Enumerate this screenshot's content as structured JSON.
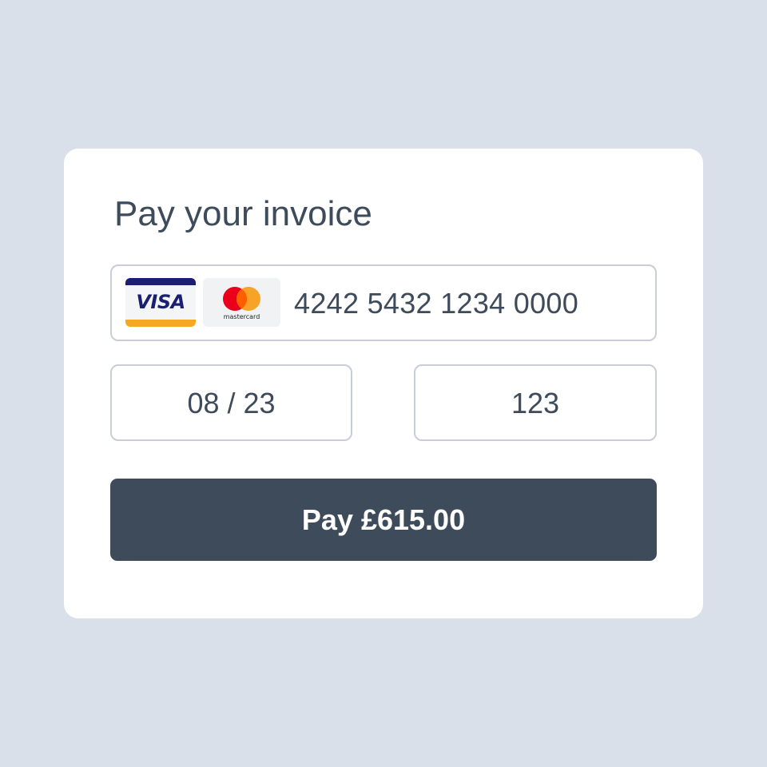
{
  "page_title": "Pay your invoice",
  "card_number": {
    "value": "4242 5432 1234 0000",
    "brands": [
      {
        "name": "visa",
        "label": "VISA",
        "icon": "visa-logo"
      },
      {
        "name": "mastercard",
        "label": "mastercard",
        "icon": "mastercard-logo"
      }
    ]
  },
  "expiry": {
    "value": "08 / 23"
  },
  "cvc": {
    "value": "123"
  },
  "pay_button": {
    "label": "Pay £615.00"
  },
  "colors": {
    "background": "#d9e0ea",
    "card": "#ffffff",
    "text": "#3e4b5a",
    "field_border": "#c7ced8",
    "button": "#3e4b5a",
    "visa_blue": "#1a1f71",
    "visa_gold": "#f7a823",
    "mastercard_red": "#eb001b",
    "mastercard_orange": "#f79e1b"
  }
}
